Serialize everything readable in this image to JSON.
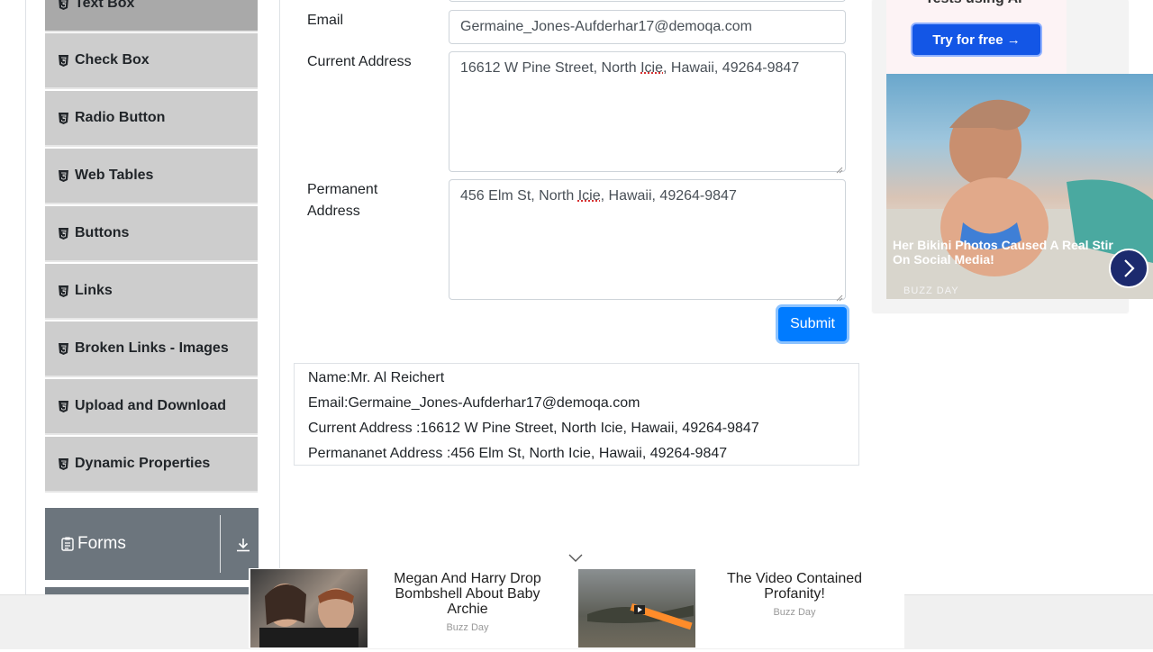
{
  "sidebar": {
    "items": [
      {
        "label": "Text Box",
        "active": true
      },
      {
        "label": "Check Box"
      },
      {
        "label": "Radio Button"
      },
      {
        "label": "Web Tables"
      },
      {
        "label": "Buttons"
      },
      {
        "label": "Links"
      },
      {
        "label": "Broken Links - Images"
      },
      {
        "label": "Upload and Download"
      },
      {
        "label": "Dynamic Properties"
      }
    ],
    "group": {
      "label": "Forms",
      "icon": "clipboard-icon",
      "toggle_icon": "download-arrow-icon"
    }
  },
  "form": {
    "email_label": "Email",
    "email_value": "Germaine_Jones-Aufderhar17@demoqa.com",
    "current_label": "Current Address",
    "current_value_pre": "16612 W Pine Street, North ",
    "current_value_word": "Icie,",
    "current_value_post": " Hawaii, 49264-9847",
    "permanent_label_1": "Permanent",
    "permanent_label_2": "Address",
    "permanent_value_pre": "456 Elm St, North ",
    "permanent_value_word": "Icie",
    "permanent_value_post": ", Hawaii, 49264-9847",
    "submit_label": "Submit"
  },
  "output": {
    "name": "Name:Mr. Al Reichert",
    "email": "Email:Germaine_Jones-Aufderhar17@demoqa.com",
    "current": "Current Address :16612 W Pine Street, North Icie, Hawaii, 49264-9847",
    "permanent": "Permananet Address :456 Elm St, North Icie, Hawaii, 49264-9847"
  },
  "ad_right": {
    "top_text": "Tests using AI",
    "button": "Try for free →",
    "caption": "Her Bikini Photos Caused A Real Stir On Social Media!",
    "source": "BUZZ DAY"
  },
  "ad_bottom": {
    "title1": "Megan And Harry Drop Bombshell About Baby Archie",
    "source1": "Buzz Day",
    "title2": "The Video Contained Profanity!",
    "source2": "Buzz Day"
  },
  "colors": {
    "accent": "#007bff",
    "sidebar_item": "#cdcdcd",
    "sidebar_active": "#a9a9a9",
    "group_header": "#6c757d"
  }
}
